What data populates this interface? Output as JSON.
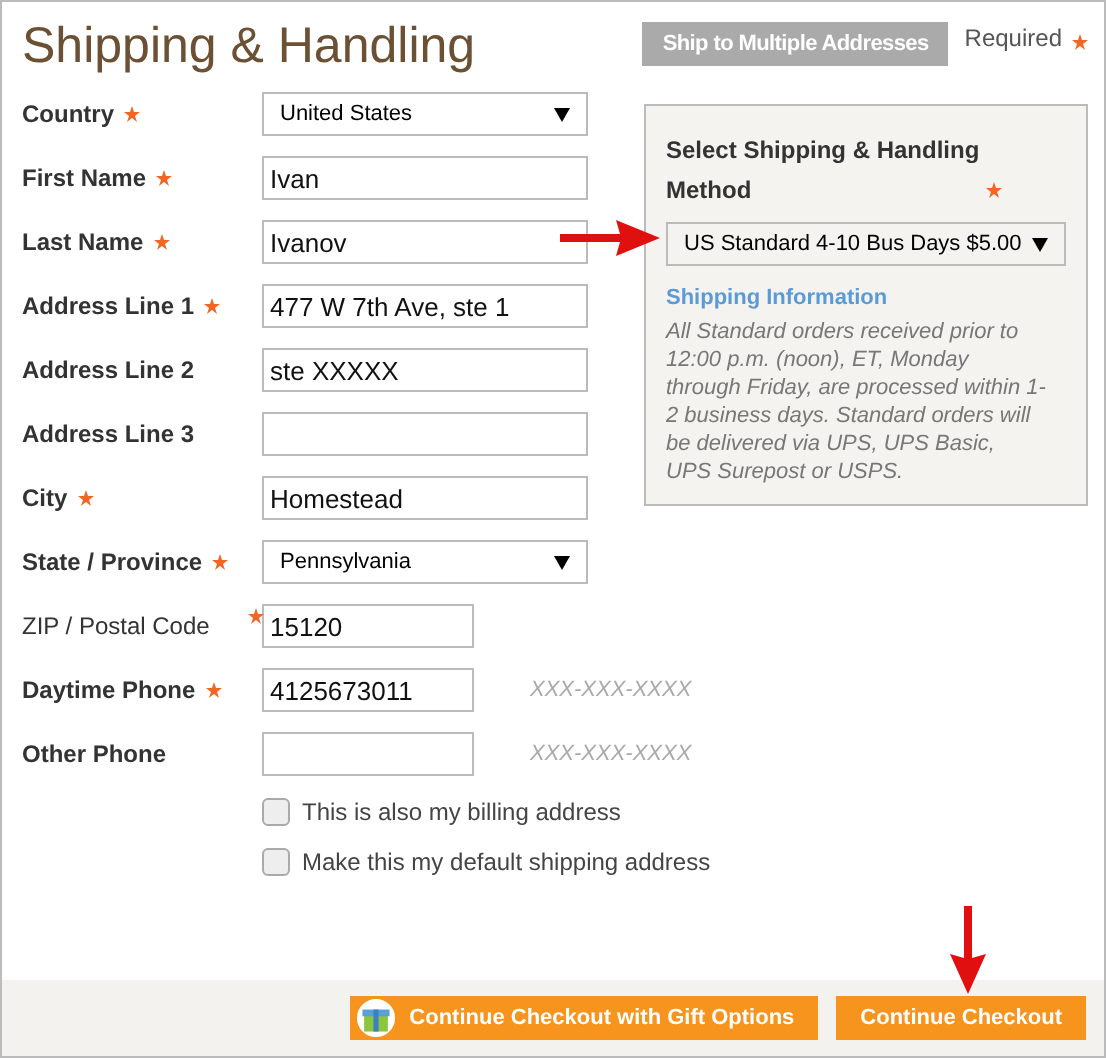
{
  "title": "Shipping & Handling",
  "multi_button": "Ship to Multiple Addresses",
  "required_note": "Required",
  "fields": [
    {
      "label": "Country",
      "kind": "select",
      "required": true,
      "star_at_field": false,
      "value": "United States"
    },
    {
      "label": "First Name",
      "kind": "text",
      "required": true,
      "star_at_field": false,
      "value": "Ivan"
    },
    {
      "label": "Last Name",
      "kind": "text",
      "required": true,
      "star_at_field": false,
      "value": "Ivanov"
    },
    {
      "label": "Address Line 1",
      "kind": "text",
      "required": true,
      "star_at_field": false,
      "value": "477 W 7th Ave, ste 1"
    },
    {
      "label": "Address Line 2",
      "kind": "text",
      "required": false,
      "star_at_field": false,
      "value": "ste XXXXX"
    },
    {
      "label": "Address Line 3",
      "kind": "text",
      "required": false,
      "star_at_field": false
    },
    {
      "label": "City",
      "kind": "text",
      "required": true,
      "star_at_field": false,
      "value": "Homestead"
    },
    {
      "label": "State / Province",
      "kind": "select",
      "required": true,
      "star_at_field": false,
      "value": "Pennsylvania"
    },
    {
      "label": "ZIP / Postal Code",
      "kind": "short",
      "required": true,
      "star_at_field": true,
      "value": "15120"
    },
    {
      "label": "Daytime Phone",
      "kind": "short",
      "required": true,
      "star_at_field": false,
      "value": "4125673011",
      "hint": "XXX-XXX-XXXX"
    },
    {
      "label": "Other Phone",
      "kind": "short",
      "required": false,
      "star_at_field": false,
      "hint": "XXX-XXX-XXXX"
    }
  ],
  "options": [
    {
      "label": "This is also my billing address",
      "checked": false
    },
    {
      "label": "Make this my default shipping address",
      "checked": false
    }
  ],
  "method_panel": {
    "heading": "Select Shipping & Handling Method",
    "value": "US Standard 4-10 Bus Days $5.00",
    "info_title": "Shipping Information",
    "info": "All Standard orders received prior to 12:00 p.m. (noon), ET, Monday through Friday, are processed within 1-2 business days. Standard orders will be delivered via UPS, UPS Basic, UPS Surepost or USPS."
  },
  "footer_buttons": [
    {
      "label": "Continue Checkout with Gift Options",
      "kind": "gift"
    },
    {
      "label": "Continue Checkout",
      "kind": "plain"
    }
  ]
}
